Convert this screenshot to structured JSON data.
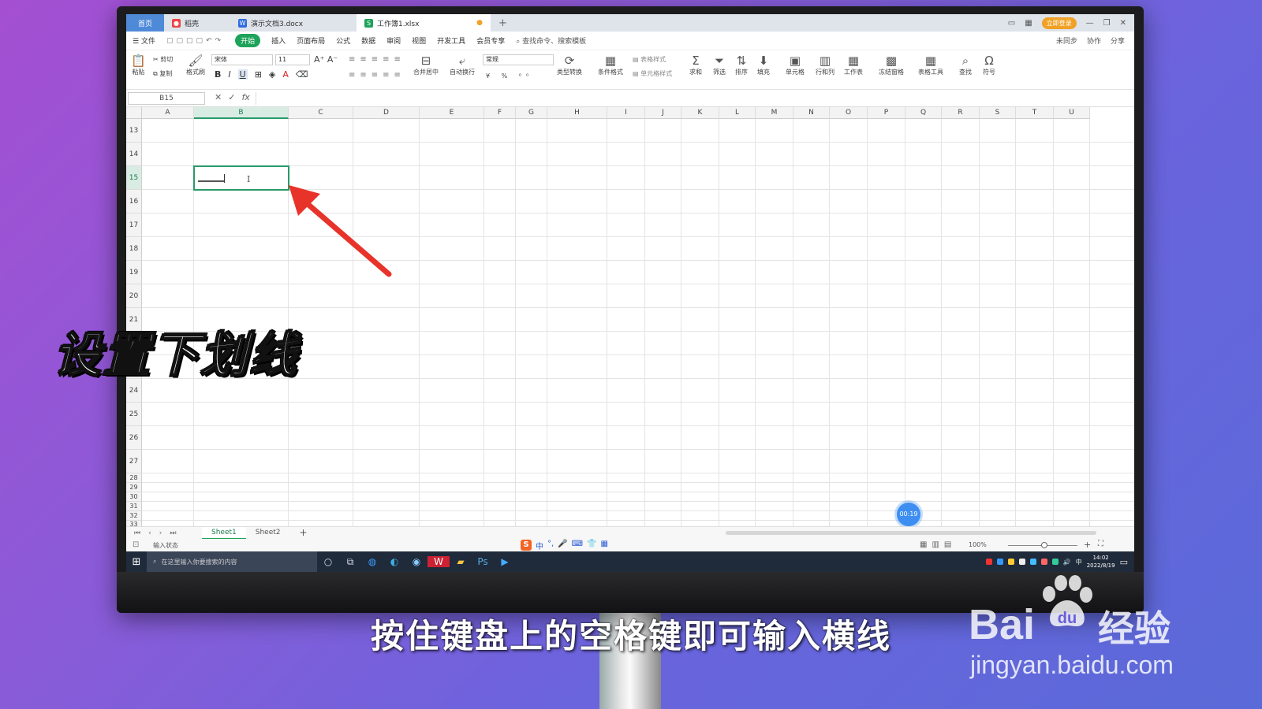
{
  "titlebar": {
    "tabs": [
      {
        "label": "首页"
      },
      {
        "label": "稻壳"
      },
      {
        "label": "演示文档3.docx"
      },
      {
        "label": "工作簿1.xlsx"
      }
    ],
    "new_tab": "+",
    "login": "立即登录"
  },
  "menu": {
    "file": "文件",
    "items": [
      "开始",
      "插入",
      "页面布局",
      "公式",
      "数据",
      "审阅",
      "视图",
      "开发工具",
      "会员专享"
    ],
    "search": "查找命令、搜索模板",
    "right": [
      "未同步",
      "协作",
      "分享"
    ]
  },
  "ribbon": {
    "paste": "粘贴",
    "cut": "剪切",
    "copy": "复制",
    "format_painter": "格式刷",
    "font": "宋体",
    "font_size": "11",
    "bold": "B",
    "italic": "I",
    "underline": "U",
    "merge": "合并居中",
    "wrap": "自动换行",
    "number_format": "常规",
    "type_convert": "类型转换",
    "cond_format": "条件格式",
    "table_style": "表格样式",
    "cell_style": "单元格样式",
    "sum": "求和",
    "filter": "筛选",
    "sort": "排序",
    "fill": "填充",
    "cell": "单元格",
    "row_col": "行和列",
    "worksheet": "工作表",
    "freeze": "冻结窗格",
    "table_tools": "表格工具",
    "find": "查找",
    "symbol": "符号"
  },
  "formula_bar": {
    "name_box": "B15",
    "fx": "fx",
    "value": ""
  },
  "grid": {
    "columns": [
      "A",
      "B",
      "C",
      "D",
      "E",
      "F",
      "G",
      "H",
      "I",
      "J",
      "K",
      "L",
      "M",
      "N",
      "O",
      "P",
      "Q",
      "R",
      "S",
      "T",
      "U"
    ],
    "rows": [
      "13",
      "14",
      "15",
      "16",
      "17",
      "18",
      "19",
      "20",
      "21",
      "22",
      "23",
      "24",
      "25",
      "26",
      "27",
      "28",
      "29",
      "30",
      "31",
      "32",
      "33"
    ],
    "selected_cell": "B15"
  },
  "sheets": {
    "tabs": [
      "Sheet1",
      "Sheet2"
    ],
    "active": "Sheet1",
    "add": "+"
  },
  "status": {
    "mode": "输入状态",
    "zoom": "100%"
  },
  "timer": "00:19",
  "taskbar": {
    "search_placeholder": "在这里输入你要搜索的内容",
    "time": "14:02",
    "date": "2022/8/19",
    "ime": "中"
  },
  "overlay": {
    "title": "设置下划线",
    "subtitle": "按住键盘上的空格键即可输入横线"
  },
  "watermark": {
    "brand": "Bai",
    "du": "du",
    "product": "经验",
    "url": "jingyan.baidu.com"
  },
  "colors": {
    "accent_green": "#1ea35a",
    "arrow_red": "#e8332a",
    "selection_green": "#2a9a6a"
  }
}
